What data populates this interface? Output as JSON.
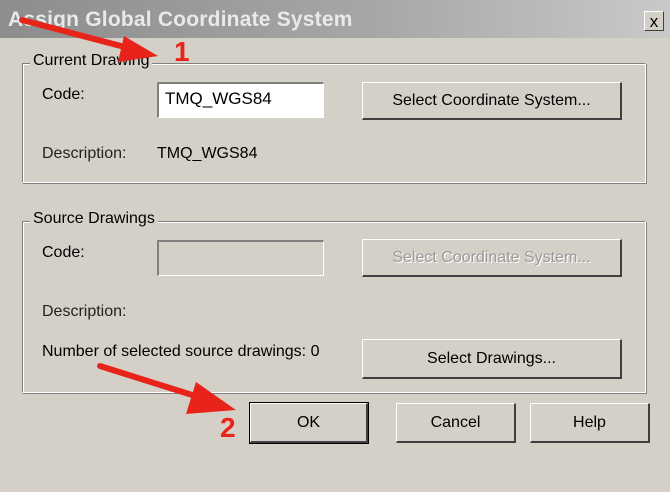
{
  "window": {
    "title": "Assign Global Coordinate System",
    "close_glyph": "x"
  },
  "current": {
    "legend": "Current Drawing",
    "code_label": "Code:",
    "code_value": "TMQ_WGS84",
    "select_btn": "Select Coordinate System...",
    "desc_label": "Description:",
    "desc_value": "TMQ_WGS84"
  },
  "source": {
    "legend": "Source Drawings",
    "code_label": "Code:",
    "code_value": "",
    "select_btn": "Select Coordinate System...",
    "desc_label": "Description:",
    "count_label": "Number of selected source drawings: 0",
    "select_drawings_btn": "Select Drawings..."
  },
  "footer": {
    "ok": "OK",
    "cancel": "Cancel",
    "help": "Help"
  },
  "annotations": {
    "step1": "1",
    "step2": "2",
    "arrow_color": "#e8231a"
  }
}
